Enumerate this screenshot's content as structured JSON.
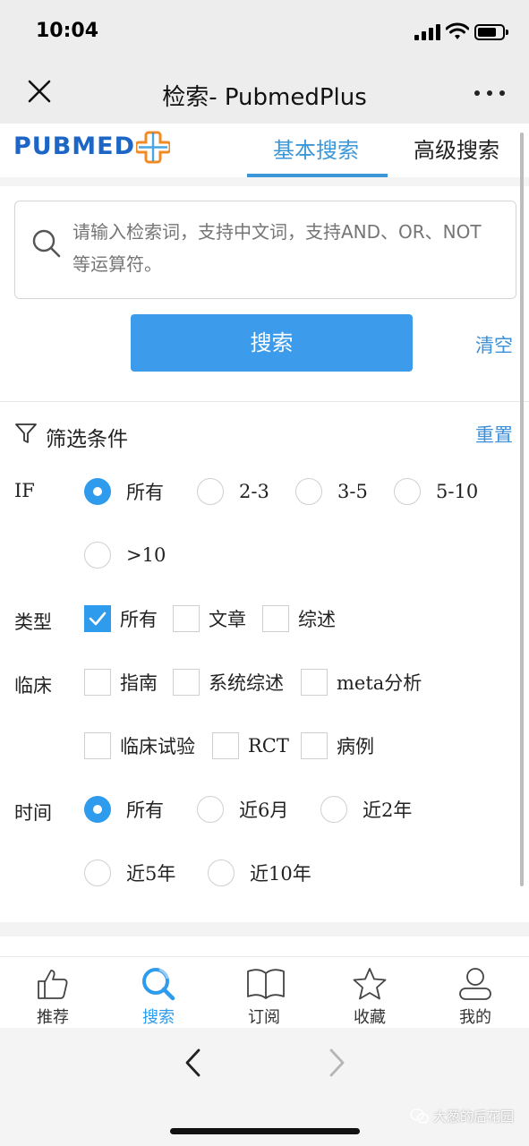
{
  "status_bar": {
    "time": "10:04"
  },
  "nav": {
    "title": "检索- PubmedPlus"
  },
  "header": {
    "logo_text": "PUBMED",
    "tabs": [
      {
        "label": "基本搜索",
        "active": true
      },
      {
        "label": "高级搜索",
        "active": false
      }
    ]
  },
  "search": {
    "placeholder": "请输入检索词，支持中文词，支持AND、OR、NOT等运算符。",
    "button_label": "搜索",
    "clear_label": "清空"
  },
  "filters": {
    "title": "筛选条件",
    "reset_label": "重置",
    "if": {
      "label": "IF",
      "options": [
        "所有",
        "2-3",
        "3-5",
        "5-10",
        ">10"
      ],
      "selected": "所有"
    },
    "type": {
      "label": "类型",
      "options": [
        "所有",
        "文章",
        "综述"
      ],
      "checked": [
        "所有"
      ]
    },
    "clinical": {
      "label": "临床",
      "options": [
        "指南",
        "系统综述",
        "meta分析",
        "临床试验",
        "RCT",
        "病例"
      ],
      "checked": []
    },
    "time": {
      "label": "时间",
      "options": [
        "所有",
        "近6月",
        "近2年",
        "近5年",
        "近10年"
      ],
      "selected": "所有"
    }
  },
  "tabbar": {
    "items": [
      {
        "label": "推荐",
        "icon": "thumbs-up-icon"
      },
      {
        "label": "搜索",
        "icon": "search-icon",
        "active": true
      },
      {
        "label": "订阅",
        "icon": "book-icon"
      },
      {
        "label": "收藏",
        "icon": "star-icon"
      },
      {
        "label": "我的",
        "icon": "user-icon"
      }
    ]
  },
  "watermark": "大葱的后花园",
  "colors": {
    "accent": "#2f9bec",
    "logo": "#1d66c6"
  }
}
